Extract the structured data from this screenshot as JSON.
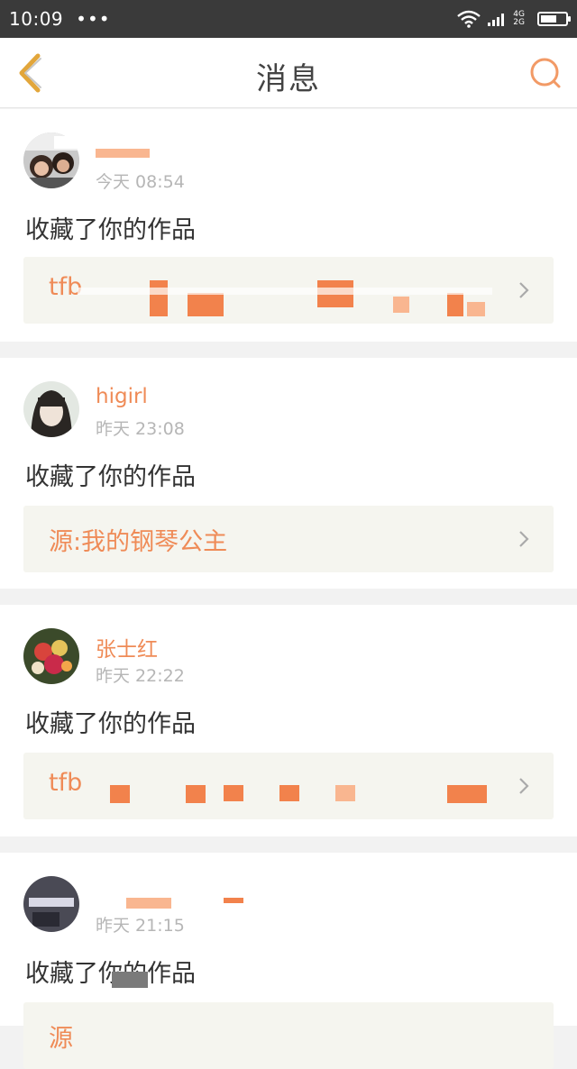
{
  "status_bar": {
    "time": "10:09",
    "dots": "•••",
    "net_top": "4G",
    "net_bottom": "2G"
  },
  "header": {
    "title": "消息"
  },
  "messages": [
    {
      "user": "",
      "time": "今天 08:54",
      "action": "收藏了你的作品",
      "link": "tfb"
    },
    {
      "user": "higirl",
      "time": "昨天 23:08",
      "action": "收藏了你的作品",
      "link": "源:我的钢琴公主"
    },
    {
      "user": "张士红",
      "time": "昨天 22:22",
      "action": "收藏了你的作品",
      "link": "tfb"
    },
    {
      "user": "",
      "time": "昨天 21:15",
      "action": "收藏了你的作品",
      "link": "源"
    }
  ],
  "colors": {
    "accent": "#ef8b57",
    "status_bar": "#3a3a3a",
    "link_bg": "#f5f5ef",
    "page_bg": "#f2f2f2"
  }
}
